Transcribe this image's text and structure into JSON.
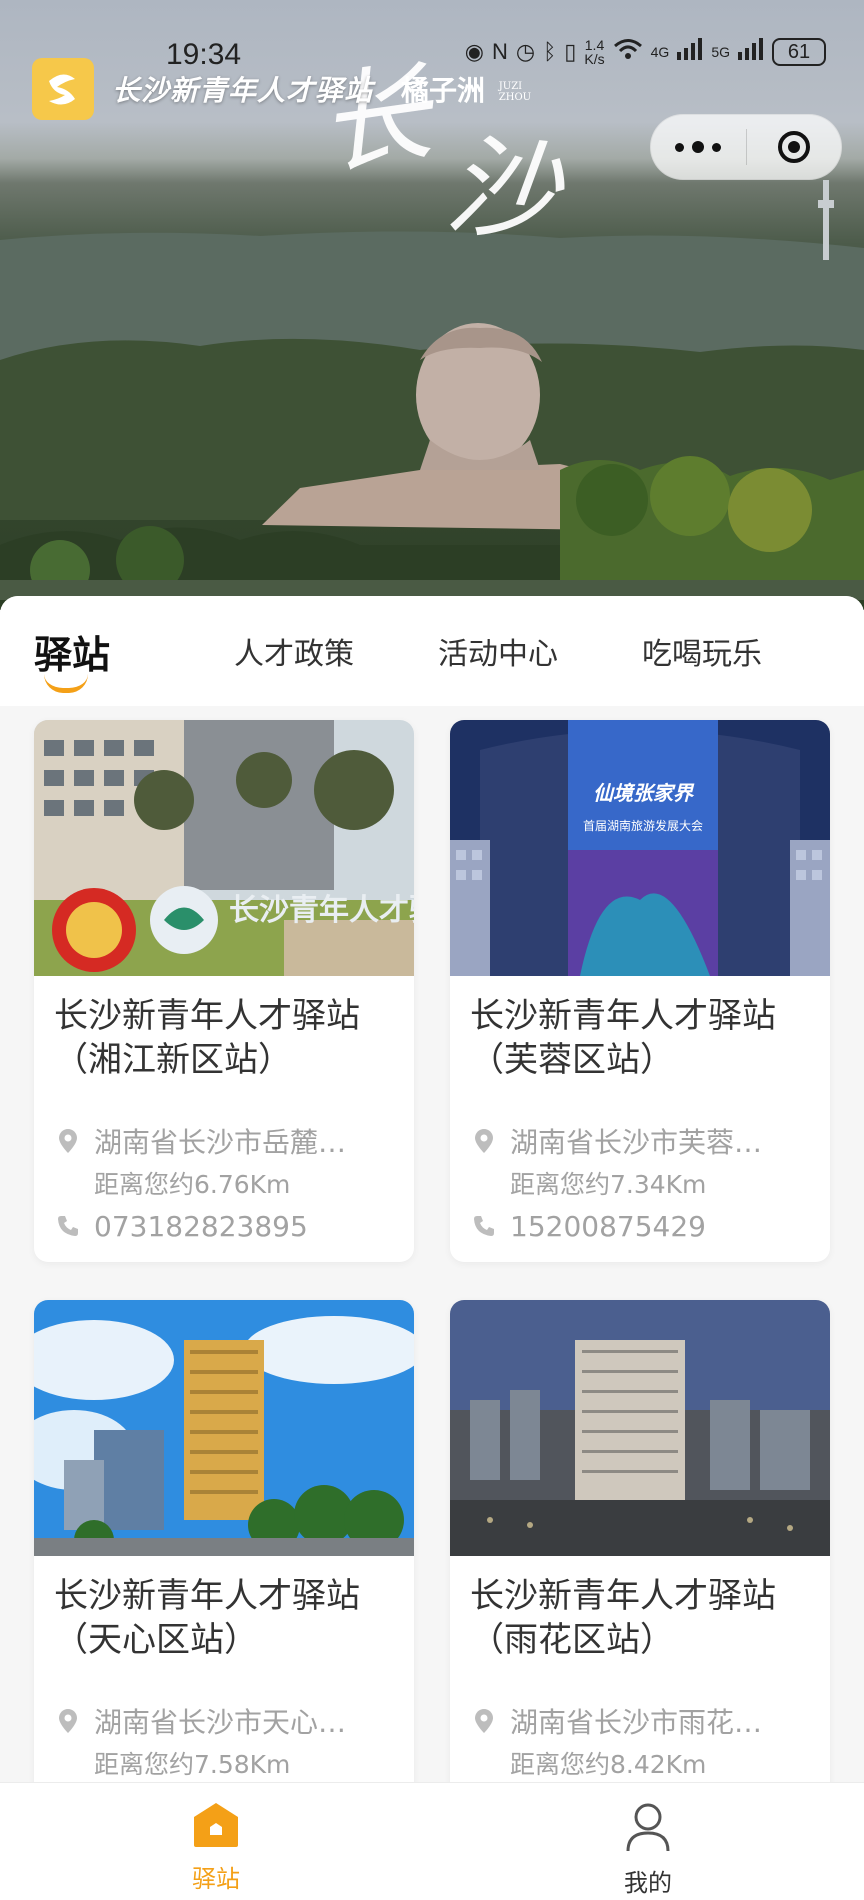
{
  "status_bar": {
    "time": "19:34",
    "net_speed_value": "1.4",
    "net_speed_unit": "K/s",
    "network_4g": "4G",
    "network_5g": "5G",
    "battery": "61"
  },
  "header": {
    "app_title": "长沙新青年人才驿站",
    "hero_subtitle": "橘子洲",
    "hero_subtitle_latin": "JUZI ZHOU",
    "hero_calligraphy_1": "长",
    "hero_calligraphy_2": "沙"
  },
  "tabs": [
    {
      "label": "驿站",
      "active": true
    },
    {
      "label": "人才政策",
      "active": false
    },
    {
      "label": "活动中心",
      "active": false
    },
    {
      "label": "吃喝玩乐",
      "active": false
    }
  ],
  "stations": [
    {
      "name_line1": "长沙新青年人才驿站",
      "name_line2": "（湘江新区站）",
      "address": "湖南省长沙市岳麓…",
      "distance": "距离您约6.76Km",
      "phone": "073182823895",
      "photo_text": "长沙青年人才驿站"
    },
    {
      "name_line1": "长沙新青年人才驿站",
      "name_line2": "（芙蓉区站）",
      "address": "湖南省长沙市芙蓉…",
      "distance": "距离您约7.34Km",
      "phone": "15200875429",
      "photo_text_1": "仙境张家界",
      "photo_text_2": "首届湖南旅游发展大会"
    },
    {
      "name_line1": "长沙新青年人才驿站",
      "name_line2": "（天心区站）",
      "address": "湖南省长沙市天心…",
      "distance": "距离您约7.58Km",
      "phone": ""
    },
    {
      "name_line1": "长沙新青年人才驿站",
      "name_line2": "（雨花区站）",
      "address": "湖南省长沙市雨花…",
      "distance": "距离您约8.42Km",
      "phone": ""
    }
  ],
  "bottom_nav": [
    {
      "label": "驿站",
      "icon": "home-icon",
      "active": true
    },
    {
      "label": "我的",
      "icon": "person-icon",
      "active": false
    }
  ],
  "colors": {
    "accent": "#f4a017",
    "card_bg": "#ffffff",
    "page_bg": "#f6f6f6",
    "muted_text": "#a2a2a2"
  }
}
